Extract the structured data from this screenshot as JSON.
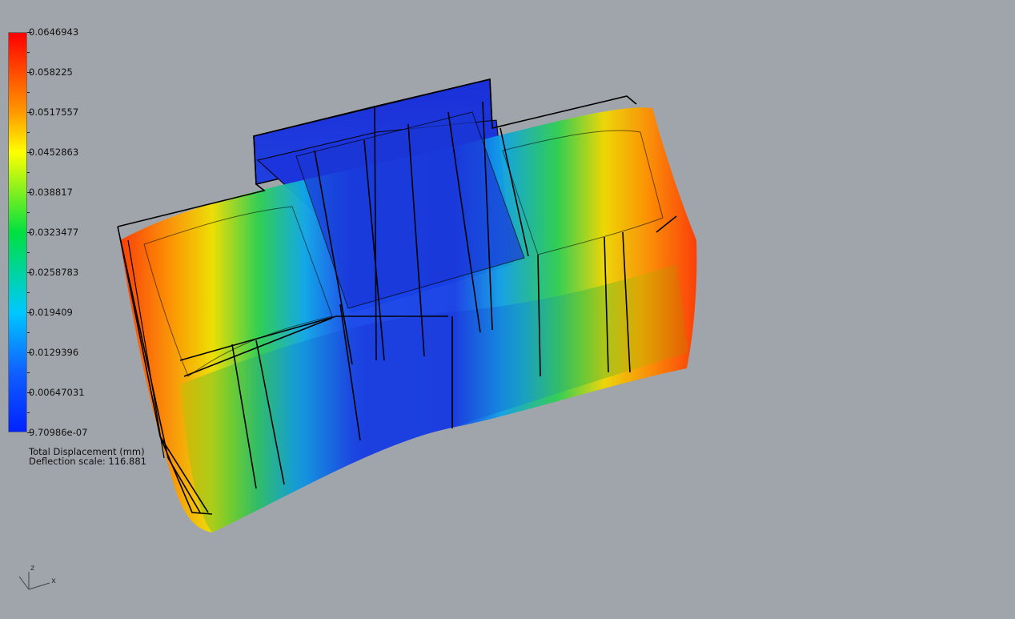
{
  "viewport": {
    "background_color": "#a0a5ab"
  },
  "legend": {
    "color_scale": [
      "#0022ff",
      "#00c8ff",
      "#00e040",
      "#ffff00",
      "#ff9900",
      "#ff0000"
    ],
    "labels": [
      "0.0646943",
      "0.058225",
      "0.0517557",
      "0.0452863",
      "0.038817",
      "0.0323477",
      "0.0258783",
      "0.019409",
      "0.0129396",
      "0.00647031",
      "9.70986e-07"
    ]
  },
  "caption": {
    "line1": "Total Displacement (mm)",
    "line2": "Deflection scale: 116.881"
  },
  "axes": {
    "z": "z",
    "x": "x"
  }
}
